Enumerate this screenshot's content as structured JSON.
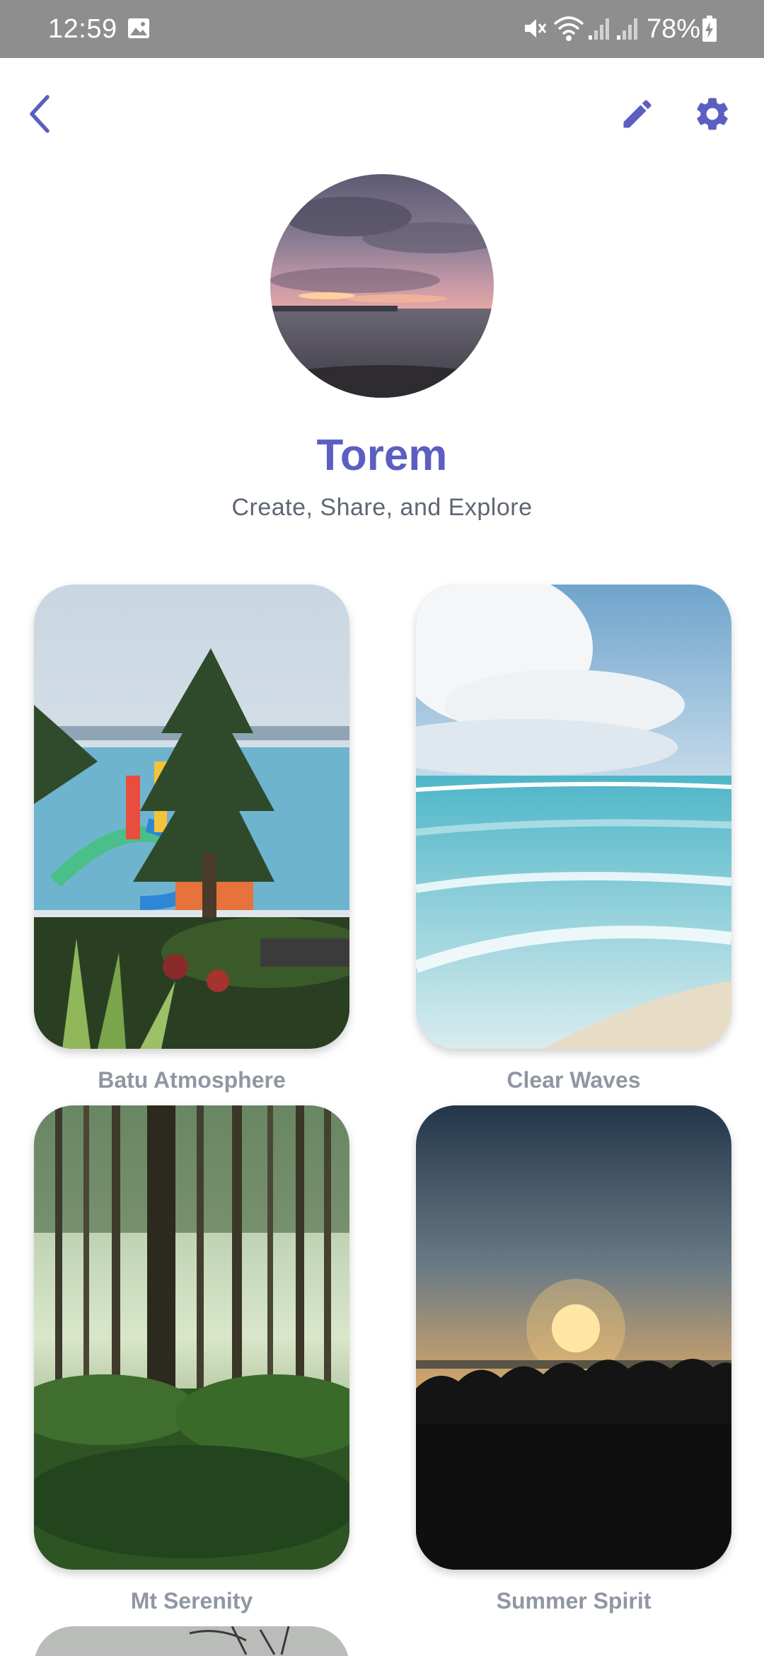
{
  "status_bar": {
    "time": "12:59",
    "battery": "78%",
    "icons": [
      "image-icon",
      "mute-icon",
      "wifi-icon",
      "signal-icon",
      "signal-icon",
      "battery-charging-icon"
    ]
  },
  "toolbar": {
    "back_icon": "chevron-left-icon",
    "edit_icon": "pencil-icon",
    "settings_icon": "gear-icon",
    "accent_color": "#5b5fc1"
  },
  "profile": {
    "name": "Torem",
    "tagline": "Create, Share, and Explore"
  },
  "gallery": {
    "items": [
      {
        "title": "Batu Atmosphere"
      },
      {
        "title": "Clear Waves"
      },
      {
        "title": "Mt Serenity"
      },
      {
        "title": "Summer Spirit"
      }
    ]
  }
}
